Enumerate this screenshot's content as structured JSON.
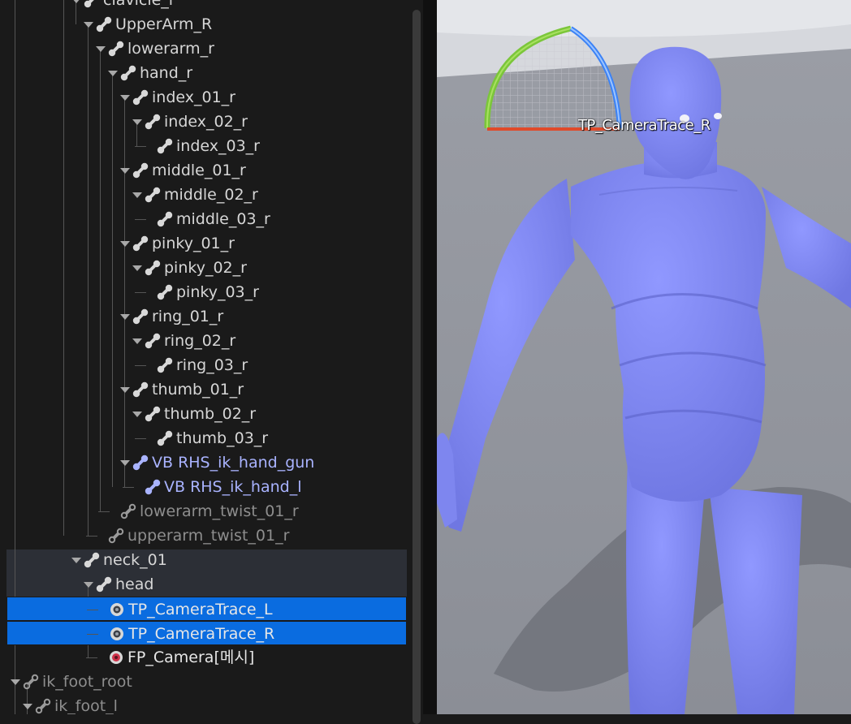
{
  "skeleton_tree": {
    "rows": [
      {
        "label": "clavicle_l",
        "depth": 6,
        "expanded": true,
        "kind": "bone"
      },
      {
        "label": "UpperArm_R",
        "depth": 7,
        "expanded": true,
        "kind": "bone"
      },
      {
        "label": "lowerarm_r",
        "depth": 8,
        "expanded": true,
        "kind": "bone"
      },
      {
        "label": "hand_r",
        "depth": 9,
        "expanded": true,
        "kind": "bone"
      },
      {
        "label": "index_01_r",
        "depth": 10,
        "expanded": true,
        "kind": "bone"
      },
      {
        "label": "index_02_r",
        "depth": 11,
        "expanded": true,
        "kind": "bone"
      },
      {
        "label": "index_03_r",
        "depth": 12,
        "expanded": false,
        "kind": "bone"
      },
      {
        "label": "middle_01_r",
        "depth": 10,
        "expanded": true,
        "kind": "bone"
      },
      {
        "label": "middle_02_r",
        "depth": 11,
        "expanded": true,
        "kind": "bone"
      },
      {
        "label": "middle_03_r",
        "depth": 12,
        "expanded": false,
        "kind": "bone"
      },
      {
        "label": "pinky_01_r",
        "depth": 10,
        "expanded": true,
        "kind": "bone"
      },
      {
        "label": "pinky_02_r",
        "depth": 11,
        "expanded": true,
        "kind": "bone"
      },
      {
        "label": "pinky_03_r",
        "depth": 12,
        "expanded": false,
        "kind": "bone"
      },
      {
        "label": "ring_01_r",
        "depth": 10,
        "expanded": true,
        "kind": "bone"
      },
      {
        "label": "ring_02_r",
        "depth": 11,
        "expanded": true,
        "kind": "bone"
      },
      {
        "label": "ring_03_r",
        "depth": 12,
        "expanded": false,
        "kind": "bone"
      },
      {
        "label": "thumb_01_r",
        "depth": 10,
        "expanded": true,
        "kind": "bone"
      },
      {
        "label": "thumb_02_r",
        "depth": 11,
        "expanded": true,
        "kind": "bone"
      },
      {
        "label": "thumb_03_r",
        "depth": 12,
        "expanded": false,
        "kind": "bone"
      },
      {
        "label": "VB RHS_ik_hand_gun",
        "depth": 10,
        "expanded": true,
        "kind": "virtual"
      },
      {
        "label": "VB RHS_ik_hand_l",
        "depth": 11,
        "expanded": false,
        "kind": "virtual"
      },
      {
        "label": "lowerarm_twist_01_r",
        "depth": 9,
        "expanded": false,
        "kind": "twist"
      },
      {
        "label": "upperarm_twist_01_r",
        "depth": 8,
        "expanded": false,
        "kind": "twist"
      },
      {
        "label": "neck_01",
        "depth": 6,
        "expanded": true,
        "kind": "bone"
      },
      {
        "label": "head",
        "depth": 7,
        "expanded": true,
        "kind": "bone"
      },
      {
        "label": "TP_CameraTrace_L",
        "depth": 8,
        "expanded": false,
        "kind": "socket",
        "selected": true
      },
      {
        "label": "TP_CameraTrace_R",
        "depth": 8,
        "expanded": false,
        "kind": "socket",
        "selected": true
      },
      {
        "label": "FP_Camera[메시]",
        "depth": 8,
        "expanded": false,
        "kind": "mesh-socket"
      },
      {
        "label": "ik_foot_root",
        "depth": 1,
        "expanded": true,
        "kind": "twist"
      },
      {
        "label": "ik_foot_l",
        "depth": 2,
        "expanded": true,
        "kind": "twist"
      }
    ]
  },
  "viewport": {
    "socket_label": "TP_CameraTrace_R"
  },
  "colors": {
    "selection": "#0a6ce0",
    "mannequin": "#7f86f0",
    "virtual_bone": "#a9b3ff"
  }
}
